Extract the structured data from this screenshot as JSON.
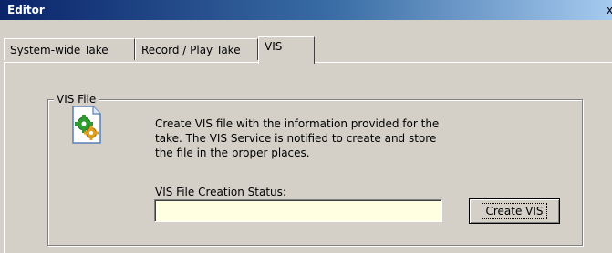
{
  "window": {
    "title": "Editor",
    "close_glyph": "x"
  },
  "tabs": [
    {
      "label": "System-wide Take",
      "active": false
    },
    {
      "label": "Record / Play Take",
      "active": false
    },
    {
      "label": "VIS",
      "active": true
    }
  ],
  "vis_group": {
    "legend": "VIS File",
    "icon": "document-gear-icon",
    "description": "Create VIS file with the information provided for the take. The VIS Service is notified to create and store the file in the proper places.",
    "status_label": "VIS File Creation Status:",
    "status_value": "",
    "create_button_label": "Create VIS"
  },
  "colors": {
    "title_bar_start": "#0a246a",
    "title_bar_end": "#a6caf0",
    "status_field_bg": "#ffffe1",
    "panel_bg": "#d4d0c8"
  }
}
